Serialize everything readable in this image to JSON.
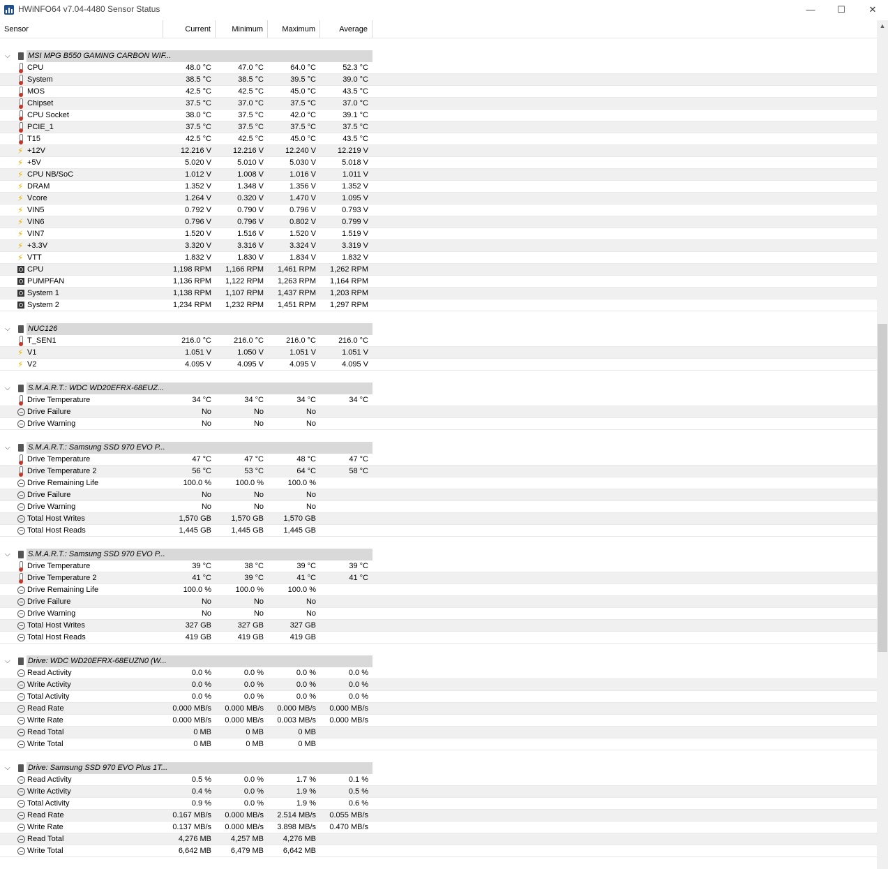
{
  "window": {
    "title": "HWiNFO64 v7.04-4480 Sensor Status",
    "controls": {
      "minimize": "—",
      "maximize": "☐",
      "close": "✕"
    }
  },
  "columns": [
    "Sensor",
    "Current",
    "Minimum",
    "Maximum",
    "Average"
  ],
  "groups": [
    {
      "name": "MSI MPG B550 GAMING CARBON WIF...",
      "rows": [
        {
          "icon": "temp",
          "name": "CPU",
          "cur": "48.0 °C",
          "min": "47.0 °C",
          "max": "64.0 °C",
          "avg": "52.3 °C"
        },
        {
          "icon": "temp",
          "name": "System",
          "cur": "38.5 °C",
          "min": "38.5 °C",
          "max": "39.5 °C",
          "avg": "39.0 °C"
        },
        {
          "icon": "temp",
          "name": "MOS",
          "cur": "42.5 °C",
          "min": "42.5 °C",
          "max": "45.0 °C",
          "avg": "43.5 °C"
        },
        {
          "icon": "temp",
          "name": "Chipset",
          "cur": "37.5 °C",
          "min": "37.0 °C",
          "max": "37.5 °C",
          "avg": "37.0 °C"
        },
        {
          "icon": "temp",
          "name": "CPU Socket",
          "cur": "38.0 °C",
          "min": "37.5 °C",
          "max": "42.0 °C",
          "avg": "39.1 °C"
        },
        {
          "icon": "temp",
          "name": "PCIE_1",
          "cur": "37.5 °C",
          "min": "37.5 °C",
          "max": "37.5 °C",
          "avg": "37.5 °C"
        },
        {
          "icon": "temp",
          "name": "T15",
          "cur": "42.5 °C",
          "min": "42.5 °C",
          "max": "45.0 °C",
          "avg": "43.5 °C"
        },
        {
          "icon": "volt",
          "name": "+12V",
          "cur": "12.216 V",
          "min": "12.216 V",
          "max": "12.240 V",
          "avg": "12.219 V"
        },
        {
          "icon": "volt",
          "name": "+5V",
          "cur": "5.020 V",
          "min": "5.010 V",
          "max": "5.030 V",
          "avg": "5.018 V"
        },
        {
          "icon": "volt",
          "name": "CPU NB/SoC",
          "cur": "1.012 V",
          "min": "1.008 V",
          "max": "1.016 V",
          "avg": "1.011 V"
        },
        {
          "icon": "volt",
          "name": "DRAM",
          "cur": "1.352 V",
          "min": "1.348 V",
          "max": "1.356 V",
          "avg": "1.352 V"
        },
        {
          "icon": "volt",
          "name": "Vcore",
          "cur": "1.264 V",
          "min": "0.320 V",
          "max": "1.470 V",
          "avg": "1.095 V"
        },
        {
          "icon": "volt",
          "name": "VIN5",
          "cur": "0.792 V",
          "min": "0.790 V",
          "max": "0.796 V",
          "avg": "0.793 V"
        },
        {
          "icon": "volt",
          "name": "VIN6",
          "cur": "0.796 V",
          "min": "0.796 V",
          "max": "0.802 V",
          "avg": "0.799 V"
        },
        {
          "icon": "volt",
          "name": "VIN7",
          "cur": "1.520 V",
          "min": "1.516 V",
          "max": "1.520 V",
          "avg": "1.519 V"
        },
        {
          "icon": "volt",
          "name": "+3.3V",
          "cur": "3.320 V",
          "min": "3.316 V",
          "max": "3.324 V",
          "avg": "3.319 V"
        },
        {
          "icon": "volt",
          "name": "VTT",
          "cur": "1.832 V",
          "min": "1.830 V",
          "max": "1.834 V",
          "avg": "1.832 V"
        },
        {
          "icon": "fan",
          "name": "CPU",
          "cur": "1,198 RPM",
          "min": "1,166 RPM",
          "max": "1,461 RPM",
          "avg": "1,262 RPM"
        },
        {
          "icon": "fan",
          "name": "PUMPFAN",
          "cur": "1,136 RPM",
          "min": "1,122 RPM",
          "max": "1,263 RPM",
          "avg": "1,164 RPM"
        },
        {
          "icon": "fan",
          "name": "System 1",
          "cur": "1,138 RPM",
          "min": "1,107 RPM",
          "max": "1,437 RPM",
          "avg": "1,203 RPM"
        },
        {
          "icon": "fan",
          "name": "System 2",
          "cur": "1,234 RPM",
          "min": "1,232 RPM",
          "max": "1,451 RPM",
          "avg": "1,297 RPM"
        }
      ]
    },
    {
      "name": "NUC126",
      "rows": [
        {
          "icon": "temp",
          "name": "T_SEN1",
          "cur": "216.0 °C",
          "min": "216.0 °C",
          "max": "216.0 °C",
          "avg": "216.0 °C"
        },
        {
          "icon": "volt",
          "name": "V1",
          "cur": "1.051 V",
          "min": "1.050 V",
          "max": "1.051 V",
          "avg": "1.051 V"
        },
        {
          "icon": "volt",
          "name": "V2",
          "cur": "4.095 V",
          "min": "4.095 V",
          "max": "4.095 V",
          "avg": "4.095 V"
        }
      ]
    },
    {
      "name": "S.M.A.R.T.: WDC WD20EFRX-68EUZ...",
      "rows": [
        {
          "icon": "temp",
          "name": "Drive Temperature",
          "cur": "34 °C",
          "min": "34 °C",
          "max": "34 °C",
          "avg": "34 °C"
        },
        {
          "icon": "other",
          "name": "Drive Failure",
          "cur": "No",
          "min": "No",
          "max": "No",
          "avg": ""
        },
        {
          "icon": "other",
          "name": "Drive Warning",
          "cur": "No",
          "min": "No",
          "max": "No",
          "avg": ""
        }
      ]
    },
    {
      "name": "S.M.A.R.T.: Samsung SSD 970 EVO P...",
      "rows": [
        {
          "icon": "temp",
          "name": "Drive Temperature",
          "cur": "47 °C",
          "min": "47 °C",
          "max": "48 °C",
          "avg": "47 °C"
        },
        {
          "icon": "temp",
          "name": "Drive Temperature 2",
          "cur": "56 °C",
          "min": "53 °C",
          "max": "64 °C",
          "avg": "58 °C"
        },
        {
          "icon": "other",
          "name": "Drive Remaining Life",
          "cur": "100.0 %",
          "min": "100.0 %",
          "max": "100.0 %",
          "avg": ""
        },
        {
          "icon": "other",
          "name": "Drive Failure",
          "cur": "No",
          "min": "No",
          "max": "No",
          "avg": ""
        },
        {
          "icon": "other",
          "name": "Drive Warning",
          "cur": "No",
          "min": "No",
          "max": "No",
          "avg": ""
        },
        {
          "icon": "other",
          "name": "Total Host Writes",
          "cur": "1,570 GB",
          "min": "1,570 GB",
          "max": "1,570 GB",
          "avg": ""
        },
        {
          "icon": "other",
          "name": "Total Host Reads",
          "cur": "1,445 GB",
          "min": "1,445 GB",
          "max": "1,445 GB",
          "avg": ""
        }
      ]
    },
    {
      "name": "S.M.A.R.T.: Samsung SSD 970 EVO P...",
      "rows": [
        {
          "icon": "temp",
          "name": "Drive Temperature",
          "cur": "39 °C",
          "min": "38 °C",
          "max": "39 °C",
          "avg": "39 °C"
        },
        {
          "icon": "temp",
          "name": "Drive Temperature 2",
          "cur": "41 °C",
          "min": "39 °C",
          "max": "41 °C",
          "avg": "41 °C"
        },
        {
          "icon": "other",
          "name": "Drive Remaining Life",
          "cur": "100.0 %",
          "min": "100.0 %",
          "max": "100.0 %",
          "avg": ""
        },
        {
          "icon": "other",
          "name": "Drive Failure",
          "cur": "No",
          "min": "No",
          "max": "No",
          "avg": ""
        },
        {
          "icon": "other",
          "name": "Drive Warning",
          "cur": "No",
          "min": "No",
          "max": "No",
          "avg": ""
        },
        {
          "icon": "other",
          "name": "Total Host Writes",
          "cur": "327 GB",
          "min": "327 GB",
          "max": "327 GB",
          "avg": ""
        },
        {
          "icon": "other",
          "name": "Total Host Reads",
          "cur": "419 GB",
          "min": "419 GB",
          "max": "419 GB",
          "avg": ""
        }
      ]
    },
    {
      "name": "Drive: WDC WD20EFRX-68EUZN0 (W...",
      "rows": [
        {
          "icon": "other",
          "name": "Read Activity",
          "cur": "0.0 %",
          "min": "0.0 %",
          "max": "0.0 %",
          "avg": "0.0 %"
        },
        {
          "icon": "other",
          "name": "Write Activity",
          "cur": "0.0 %",
          "min": "0.0 %",
          "max": "0.0 %",
          "avg": "0.0 %"
        },
        {
          "icon": "other",
          "name": "Total Activity",
          "cur": "0.0 %",
          "min": "0.0 %",
          "max": "0.0 %",
          "avg": "0.0 %"
        },
        {
          "icon": "other",
          "name": "Read Rate",
          "cur": "0.000 MB/s",
          "min": "0.000 MB/s",
          "max": "0.000 MB/s",
          "avg": "0.000 MB/s"
        },
        {
          "icon": "other",
          "name": "Write Rate",
          "cur": "0.000 MB/s",
          "min": "0.000 MB/s",
          "max": "0.003 MB/s",
          "avg": "0.000 MB/s"
        },
        {
          "icon": "other",
          "name": "Read Total",
          "cur": "0 MB",
          "min": "0 MB",
          "max": "0 MB",
          "avg": ""
        },
        {
          "icon": "other",
          "name": "Write Total",
          "cur": "0 MB",
          "min": "0 MB",
          "max": "0 MB",
          "avg": ""
        }
      ]
    },
    {
      "name": "Drive: Samsung SSD 970 EVO Plus 1T...",
      "rows": [
        {
          "icon": "other",
          "name": "Read Activity",
          "cur": "0.5 %",
          "min": "0.0 %",
          "max": "1.7 %",
          "avg": "0.1 %"
        },
        {
          "icon": "other",
          "name": "Write Activity",
          "cur": "0.4 %",
          "min": "0.0 %",
          "max": "1.9 %",
          "avg": "0.5 %"
        },
        {
          "icon": "other",
          "name": "Total Activity",
          "cur": "0.9 %",
          "min": "0.0 %",
          "max": "1.9 %",
          "avg": "0.6 %"
        },
        {
          "icon": "other",
          "name": "Read Rate",
          "cur": "0.167 MB/s",
          "min": "0.000 MB/s",
          "max": "2.514 MB/s",
          "avg": "0.055 MB/s"
        },
        {
          "icon": "other",
          "name": "Write Rate",
          "cur": "0.137 MB/s",
          "min": "0.000 MB/s",
          "max": "3.898 MB/s",
          "avg": "0.470 MB/s"
        },
        {
          "icon": "other",
          "name": "Read Total",
          "cur": "4,276 MB",
          "min": "4,257 MB",
          "max": "4,276 MB",
          "avg": ""
        },
        {
          "icon": "other",
          "name": "Write Total",
          "cur": "6,642 MB",
          "min": "6,479 MB",
          "max": "6,642 MB",
          "avg": ""
        }
      ]
    }
  ]
}
